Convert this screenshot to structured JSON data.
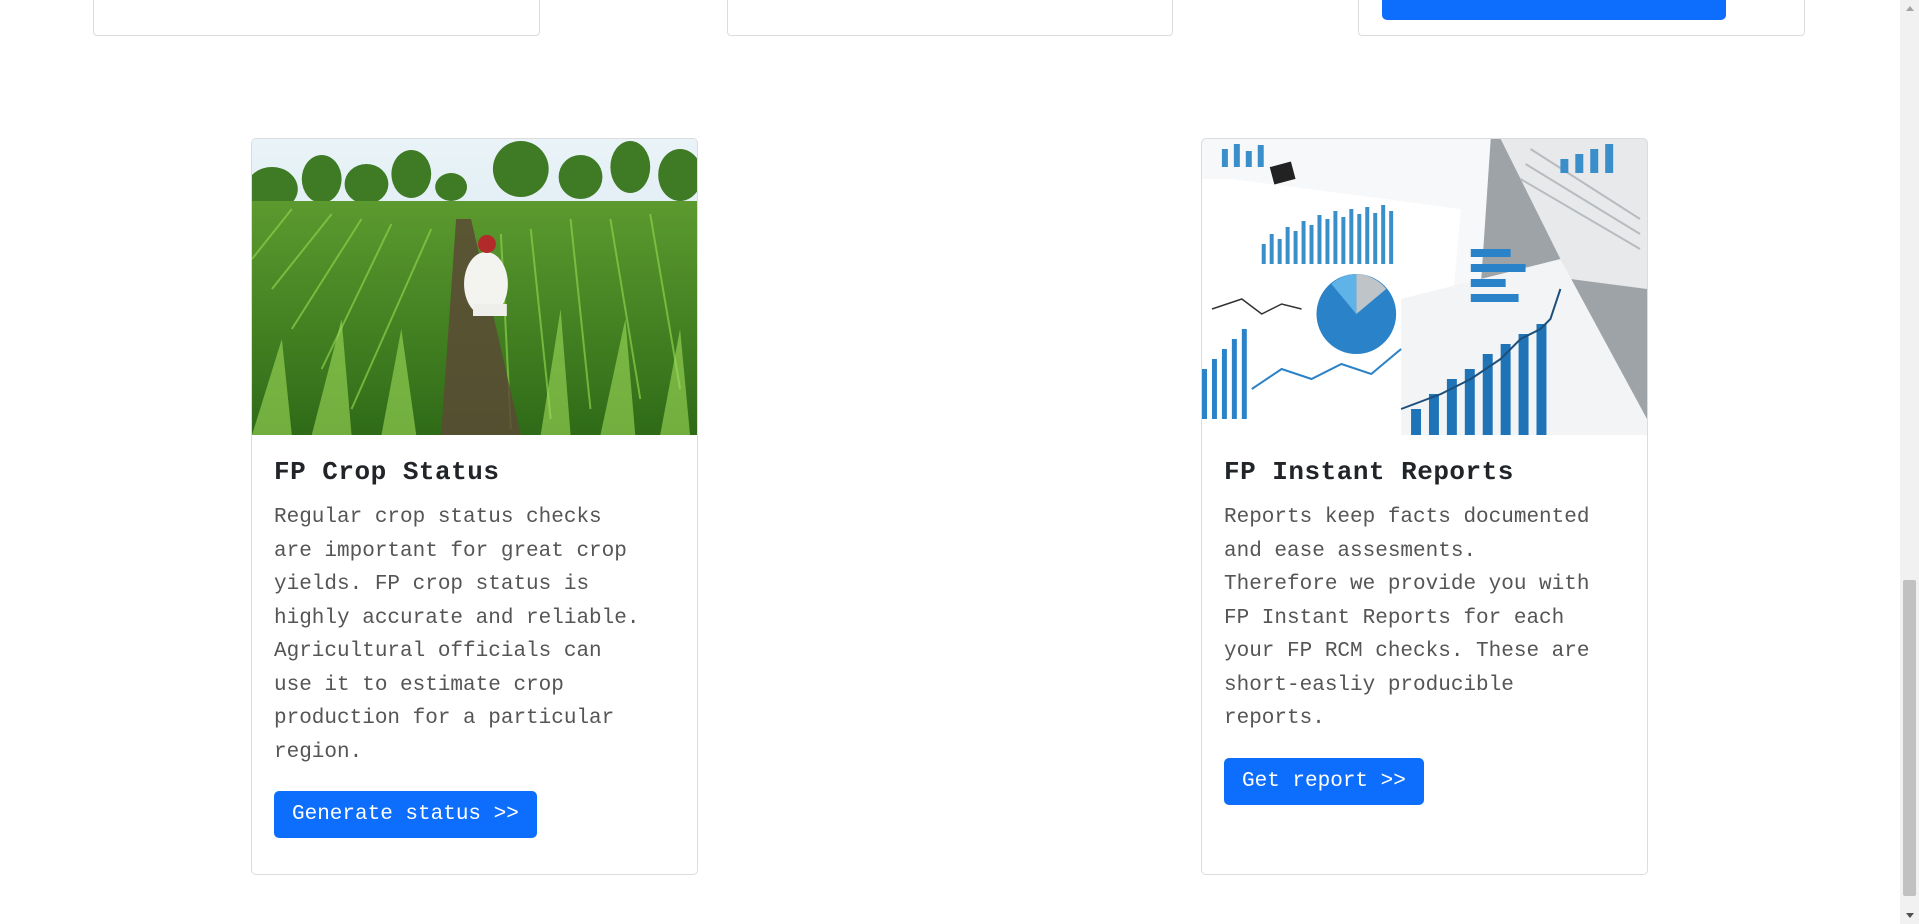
{
  "cards": [
    {
      "title": "FP Crop Status",
      "text": "Regular crop status checks\nare important for great crop\nyields. FP crop status is\nhighly accurate and reliable.\nAgricultural officials can\nuse it to estimate crop\nproduction for a particular\nregion.",
      "button": "Generate status >>",
      "image": "farmer-in-crop-field"
    },
    {
      "title": "FP Instant Reports",
      "text": "Reports keep facts documented\nand ease assesments.\nTherefore we provide you with\nFP Instant Reports for each\nyour FP RCM checks. These are\nshort-easliy producible\nreports.",
      "button": "Get report >>",
      "image": "printed-charts-and-reports"
    }
  ],
  "colors": {
    "primary": "#0d6efd",
    "text": "#212529",
    "muted_text": "#555555",
    "border": "#dcdcdc"
  }
}
